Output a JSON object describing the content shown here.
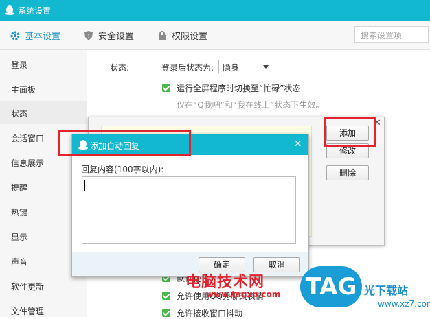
{
  "window": {
    "title": "系统设置"
  },
  "tabs": [
    {
      "label": "基本设置",
      "icon": "gear-icon"
    },
    {
      "label": "安全设置",
      "icon": "shield-icon"
    },
    {
      "label": "权限设置",
      "icon": "lock-icon"
    }
  ],
  "search": {
    "placeholder": "搜索设置项"
  },
  "sidebar": {
    "items": [
      {
        "label": "登录"
      },
      {
        "label": "主面板"
      },
      {
        "label": "状态"
      },
      {
        "label": "会话窗口"
      },
      {
        "label": "信息展示"
      },
      {
        "label": "提醒"
      },
      {
        "label": "热键"
      },
      {
        "label": "显示"
      },
      {
        "label": "声音"
      },
      {
        "label": "软件更新"
      },
      {
        "label": "文件管理"
      }
    ],
    "selected_index": 2
  },
  "status_section": {
    "label": "状态:",
    "after_login_label": "登录后状态为:",
    "after_login_value": "隐身",
    "fullscreen_option": "运行全屏程序时切换至“忙碌”状态",
    "fullscreen_hint": "仅在“Q我吧”和“我在线上”状态下生效。",
    "options_below": [
      "默认使",
      "允许使用QQ秀聊天表情",
      "允许接收窗口抖动"
    ]
  },
  "auto_reply_list_dialog": {
    "buttons": {
      "add": "添加",
      "edit": "修改",
      "delete": "删除"
    }
  },
  "add_reply_dialog": {
    "title": "添加自动回复",
    "content_label": "回复内容(100字以内):",
    "content_value": "",
    "ok": "确定",
    "cancel": "取消"
  },
  "watermark": {
    "site_name": "电脑技术网",
    "site_url": "www.tagxp.com",
    "logo_text": "TAG",
    "right_text": "光下载站",
    "right_url": "www.xz7.com"
  },
  "colors": {
    "accent": "#12b7d0",
    "highlight_box": "#e3232d",
    "checkbox": "#49b94a"
  }
}
